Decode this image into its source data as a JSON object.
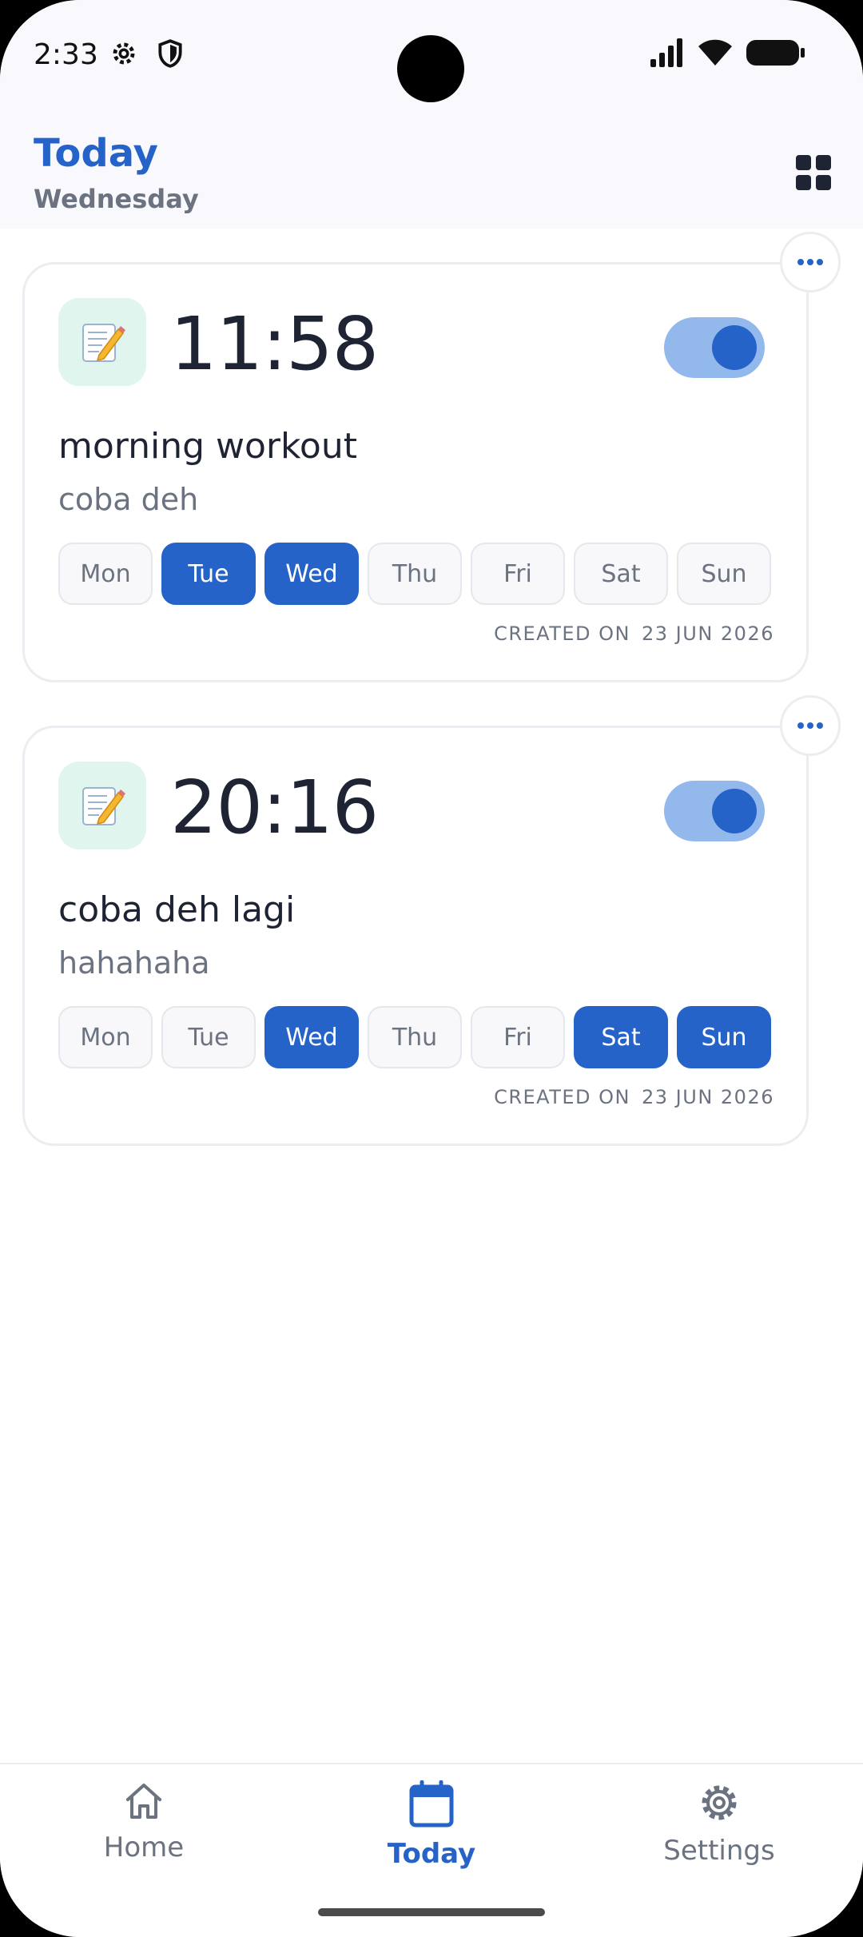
{
  "status_bar": {
    "time": "2:33"
  },
  "header": {
    "title": "Today",
    "subtitle": "Wednesday"
  },
  "alarms": [
    {
      "time": "11:58",
      "title": "morning workout",
      "description": "coba deh",
      "enabled": true,
      "days": [
        {
          "label": "Mon",
          "active": false
        },
        {
          "label": "Tue",
          "active": true
        },
        {
          "label": "Wed",
          "active": true
        },
        {
          "label": "Thu",
          "active": false
        },
        {
          "label": "Fri",
          "active": false
        },
        {
          "label": "Sat",
          "active": false
        },
        {
          "label": "Sun",
          "active": false
        }
      ],
      "created_label": "CREATED ON",
      "created_date": "23 JUN 2026",
      "icon": "memo-icon"
    },
    {
      "time": "20:16",
      "title": "coba deh lagi",
      "description": "hahahaha",
      "enabled": true,
      "days": [
        {
          "label": "Mon",
          "active": false
        },
        {
          "label": "Tue",
          "active": false
        },
        {
          "label": "Wed",
          "active": true
        },
        {
          "label": "Thu",
          "active": false
        },
        {
          "label": "Fri",
          "active": false
        },
        {
          "label": "Sat",
          "active": true
        },
        {
          "label": "Sun",
          "active": true
        }
      ],
      "created_label": "CREATED ON",
      "created_date": "23 JUN 2026",
      "icon": "memo-icon"
    }
  ],
  "nav": {
    "items": [
      {
        "label": "Home",
        "icon": "home-icon",
        "active": false
      },
      {
        "label": "Today",
        "icon": "calendar-icon",
        "active": true
      },
      {
        "label": "Settings",
        "icon": "gear-icon",
        "active": false
      }
    ]
  },
  "colors": {
    "accent": "#2563c9",
    "toggle_track": "#93b8ec",
    "icon_bg": "#dff5ee",
    "text_dark": "#1e2433",
    "text_muted": "#6b7280"
  }
}
